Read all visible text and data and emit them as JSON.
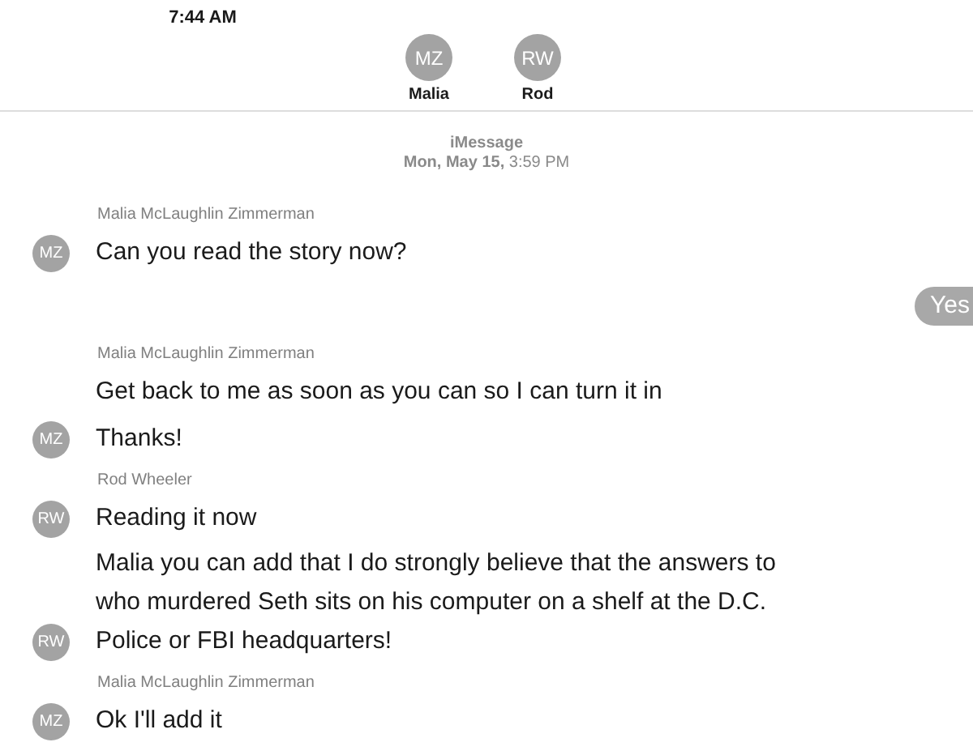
{
  "status_bar": {
    "time": "7:44 AM"
  },
  "contacts": [
    {
      "initials": "MZ",
      "name": "Malia"
    },
    {
      "initials": "RW",
      "name": "Rod"
    }
  ],
  "thread_header": {
    "service": "iMessage",
    "timestamp": "**Mon, May 15,** 3:59 PM"
  },
  "messages": [
    {
      "kind": "incoming",
      "sender": "Malia McLaughlin Zimmerman",
      "avatar": "MZ",
      "text": "Can you read the story now?"
    },
    {
      "kind": "outgoing",
      "text": "Yes"
    },
    {
      "kind": "incoming",
      "sender": "Malia McLaughlin Zimmerman",
      "text": "Get back to me as soon as you can so I can turn it in"
    },
    {
      "kind": "incoming",
      "avatar": "MZ",
      "text": "Thanks!"
    },
    {
      "kind": "incoming",
      "sender": "Rod Wheeler",
      "avatar": "RW",
      "text": "Reading it now"
    },
    {
      "kind": "incoming",
      "avatar": "RW",
      "text": "Malia you can add that I do strongly believe that the answers to who murdered Seth sits on his computer on a shelf at the D.C. Police or FBI headquarters!"
    },
    {
      "kind": "incoming",
      "sender": "Malia McLaughlin Zimmerman",
      "avatar": "MZ",
      "text": "Ok I'll add it"
    }
  ]
}
